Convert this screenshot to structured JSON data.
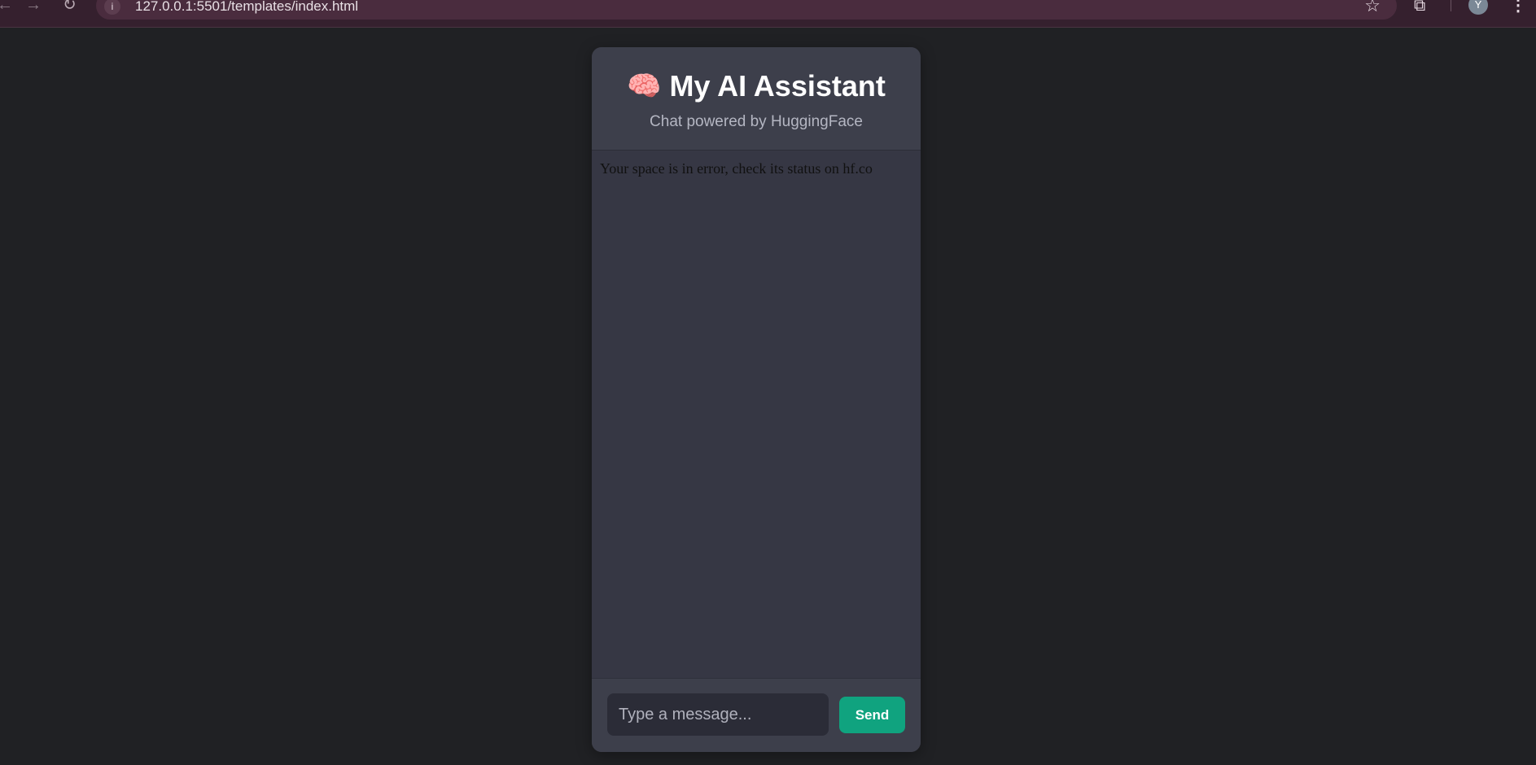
{
  "browser": {
    "url": "127.0.0.1:5501/templates/index.html",
    "back_icon": "arrow-left-icon",
    "forward_icon": "arrow-right-icon",
    "reload_icon": "reload-icon",
    "site_info_icon": "info-icon",
    "bookmark_icon": "star-icon",
    "extensions_icon": "puzzle-icon",
    "profile_initial": "Y",
    "menu_icon": "kebab-menu-icon"
  },
  "header": {
    "icon": "🧠",
    "title": "My AI Assistant",
    "subtitle": "Chat powered by HuggingFace"
  },
  "chat": {
    "messages": [
      {
        "text": "Your space is in error, check its status on hf.co"
      }
    ]
  },
  "composer": {
    "placeholder": "Type a message...",
    "value": "",
    "send_label": "Send"
  },
  "colors": {
    "page_background": "#202124",
    "card_background": "#3a3b47",
    "accent": "#10a37f",
    "browser_bar": "#35202e"
  }
}
